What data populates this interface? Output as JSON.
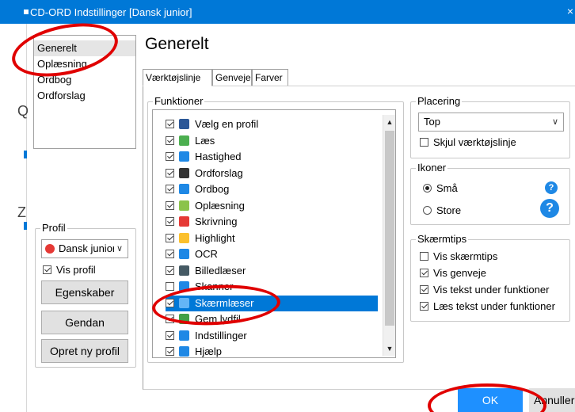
{
  "window": {
    "title": "CD-ORD Indstillinger [Dansk junior]",
    "close_glyph": "×"
  },
  "left_strip": {
    "glyph1": "Q",
    "glyph2": "Z"
  },
  "nav": {
    "items": [
      "Generelt",
      "Oplæsning",
      "Ordbog",
      "Ordforslag"
    ],
    "selected": "Generelt"
  },
  "page_title": "Generelt",
  "tabs": [
    "Værktøjslinje",
    "Genveje",
    "Farver"
  ],
  "functions": {
    "legend": "Funktioner",
    "items": [
      {
        "label": "Vælg en profil",
        "checked": true,
        "icon": "profile-icon",
        "color": "#2b5797"
      },
      {
        "label": "Læs",
        "checked": true,
        "icon": "play-icon",
        "color": "#4caf50"
      },
      {
        "label": "Hastighed",
        "checked": true,
        "icon": "speed-icon",
        "color": "#1e88e5"
      },
      {
        "label": "Ordforslag",
        "checked": true,
        "icon": "list-icon",
        "color": "#333333"
      },
      {
        "label": "Ordbog",
        "checked": true,
        "icon": "dictionary-icon",
        "color": "#1e88e5"
      },
      {
        "label": "Oplæsning",
        "checked": true,
        "icon": "speech-icon",
        "color": "#8bc34a"
      },
      {
        "label": "Skrivning",
        "checked": true,
        "icon": "pen-icon",
        "color": "#e53935"
      },
      {
        "label": "Highlight",
        "checked": true,
        "icon": "highlighter-icon",
        "color": "#fbc02d"
      },
      {
        "label": "OCR",
        "checked": true,
        "icon": "ocr-icon",
        "color": "#1e88e5"
      },
      {
        "label": "Billedlæser",
        "checked": true,
        "icon": "image-reader-icon",
        "color": "#455a64"
      },
      {
        "label": "Skanner",
        "checked": false,
        "icon": "scanner-icon",
        "color": "#1e88e5"
      },
      {
        "label": "Skærmlæser",
        "checked": true,
        "icon": "screen-reader-icon",
        "color": "#64b5f6",
        "selected": true
      },
      {
        "label": "Gem lydfil",
        "checked": true,
        "icon": "save-audio-icon",
        "color": "#43a047"
      },
      {
        "label": "Indstillinger",
        "checked": true,
        "icon": "settings-icon",
        "color": "#1e88e5"
      },
      {
        "label": "Hjælp",
        "checked": true,
        "icon": "help-icon",
        "color": "#1e88e5"
      }
    ]
  },
  "placering": {
    "legend": "Placering",
    "value": "Top",
    "hide_toolbar_label": "Skjul værktøjslinje",
    "hide_toolbar_checked": false
  },
  "ikoner": {
    "legend": "Ikoner",
    "small_label": "Små",
    "large_label": "Store",
    "selected": "Små",
    "help_glyph": "?"
  },
  "skaermtips": {
    "legend": "Skærmtips",
    "items": [
      {
        "label": "Vis skærmtips",
        "checked": false
      },
      {
        "label": "Vis genveje",
        "checked": true
      },
      {
        "label": "Vis tekst under funktioner",
        "checked": true
      },
      {
        "label": "Læs tekst under funktioner",
        "checked": true
      }
    ]
  },
  "profil": {
    "legend": "Profil",
    "selected": "Dansk junior",
    "show_profile_label": "Vis profil",
    "show_profile_checked": true,
    "buttons": {
      "properties": "Egenskaber",
      "restore": "Gendan",
      "new_profile": "Opret ny profil"
    }
  },
  "footer": {
    "ok": "OK",
    "cancel": "Annuller"
  },
  "colors": {
    "accent": "#0078d7",
    "annotation": "#e00000"
  }
}
